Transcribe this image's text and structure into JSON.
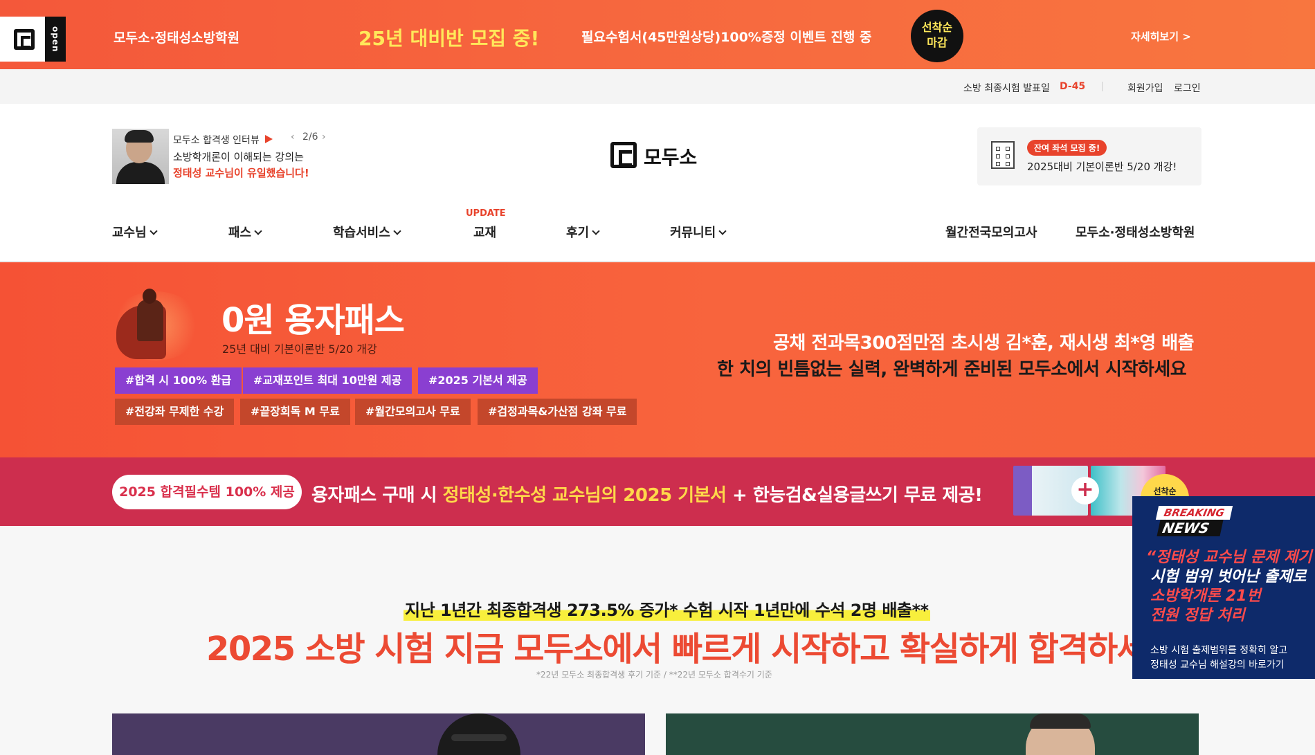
{
  "promo": {
    "logo_badge": "open",
    "academy": "모두소·정태성소방학원",
    "recruit": "25년 대비반 모집 중!",
    "event": "필요수험서(45만원상당)100%증정 이벤트 진행 중",
    "badge": [
      "선착순",
      "마감"
    ],
    "more": "자세히보기 >"
  },
  "util": {
    "exam_label": "소방 최종시험 발표일",
    "dday": "D-45",
    "join": "회원가입",
    "login": "로그인"
  },
  "interview": {
    "label": "모두소 합격생 인터뷰",
    "prev": "‹",
    "count": "2/6",
    "next": "›",
    "line1": "소방학개론이 이해되는 강의는",
    "line2": "정태성 교수님이 유일했습니다!"
  },
  "logo_text": "모두소",
  "notice": {
    "tag": "잔여 좌석 모집 중!",
    "text": "2025대비 기본이론반 5/20 개강!"
  },
  "nav": {
    "update_badge": "UPDATE",
    "items": [
      "교수님",
      "패스",
      "학습서비스",
      "교재",
      "후기",
      "커뮤니티",
      "월간전국모의고사",
      "모두소·정태성소방학원"
    ]
  },
  "hero": {
    "title": "0원 용자패스",
    "subtitle": "25년 대비 기본이론반 5/20 개강",
    "tags_purple": [
      "#합격 시 100% 환급",
      "#교재포인트 최대 10만원 제공",
      "#2025 기본서 제공"
    ],
    "tags_orange": [
      "#전강좌 무제한 수강",
      "#끝장회독 M 무료",
      "#월간모의고사 무료",
      "#검정과목&가산점 강좌 무료"
    ],
    "right_line1": "공채 전과목300점만점 초시생 김*훈, 재시생 최*영 배출",
    "right_line2": "한 치의 빈틈없는 실력, 완벽하게 준비된 모두소에서 시작하세요"
  },
  "strip": {
    "pill": "2025 합격필수템 100% 제공",
    "text_a": "용자패스 구매 시 ",
    "text_hl": "정태성·한수성 교수님의 2025 기본서",
    "text_b": " + 한능검&실용글쓰기 무료 제공!",
    "plus": "+",
    "first_badge": "선착순"
  },
  "main": {
    "stat": "지난 1년간 최종합격생 273.5% 증가* 수험 시작 1년만에 수석 2명 배출**",
    "title": "2025 소방 시험 지금 모두소에서 빠르게 시작하고 확실하게 합격하세요",
    "fine_print": "*22년 모두소 최종합격생 후기 기준 / **22년 모두소 합격수기 기준"
  },
  "news": {
    "breaking": "BREAKING",
    "news": "NEWS",
    "line1": "“정태성 교수님 문제 제기",
    "line2": "시험 범위 벗어난 출제로",
    "line3": "소방학개론 21번",
    "line4": "전원 정답 처리",
    "desc1": "소방 시험 출제범위를 정확히 알고",
    "desc2": "정태성 교수님 해설강의 바로가기"
  }
}
